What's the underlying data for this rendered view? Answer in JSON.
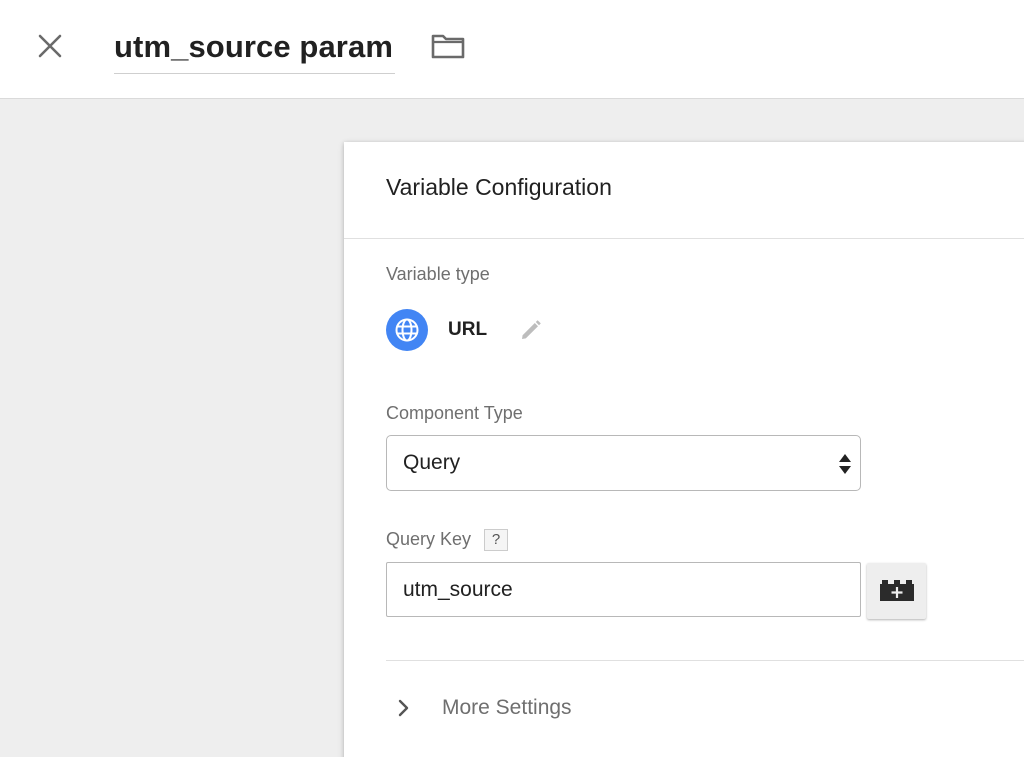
{
  "header": {
    "title": "utm_source param",
    "close_icon": "close-icon",
    "folder_icon": "folder-icon"
  },
  "card": {
    "title": "Variable Configuration",
    "variable_type_label": "Variable type",
    "variable_type": {
      "name": "URL",
      "icon": "globe-icon",
      "icon_color": "#4285f4",
      "edit_icon": "pencil-icon"
    },
    "component_type_label": "Component Type",
    "component_type_value": "Query",
    "query_key_label": "Query Key",
    "query_key_help": "?",
    "query_key_value": "utm_source",
    "variable_picker_icon": "lego-block-add-icon",
    "more_settings_label": "More Settings",
    "more_settings_icon": "chevron-right-icon"
  }
}
